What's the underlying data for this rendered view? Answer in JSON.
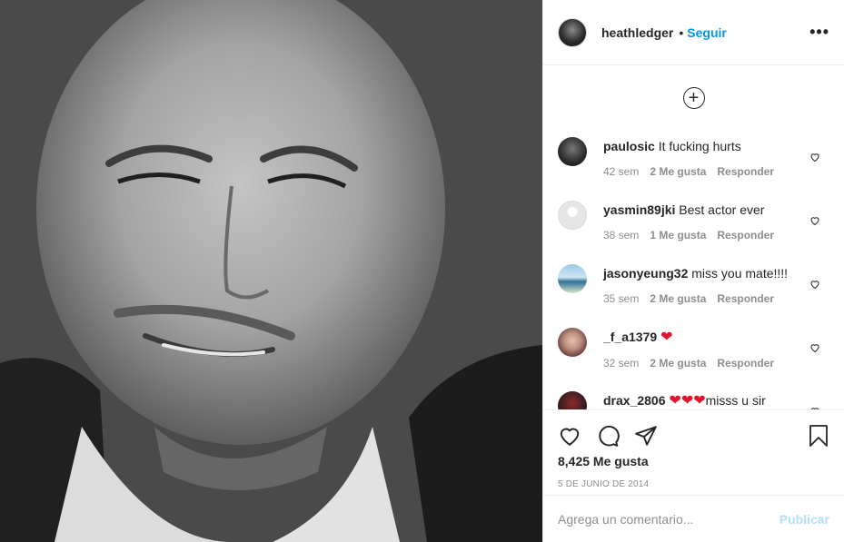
{
  "post": {
    "image_alt": "Black and white portrait photo"
  },
  "header": {
    "username": "heathledger",
    "separator": "•",
    "follow_label": "Seguir",
    "more_label": "•••"
  },
  "comments": {
    "load_more_label": "+",
    "items": [
      {
        "user": "paulosic",
        "text": "It fucking hurts",
        "emoji": "",
        "extra": "",
        "time": "42 sem",
        "likes": "2 Me gusta",
        "reply": "Responder",
        "avatar": "#2b2b2b"
      },
      {
        "user": "yasmin89jki",
        "text": "Best actor ever",
        "emoji": "",
        "extra": "",
        "time": "38 sem",
        "likes": "1 Me gusta",
        "reply": "Responder",
        "avatar": "#e8e8e8"
      },
      {
        "user": "jasonyeung32",
        "text": "miss you mate!!!!",
        "emoji": "",
        "extra": "",
        "time": "35 sem",
        "likes": "2 Me gusta",
        "reply": "Responder",
        "avatar": "#6fa8c8"
      },
      {
        "user": "_f_a1379",
        "text": "",
        "emoji": "❤",
        "extra": "",
        "time": "32 sem",
        "likes": "2 Me gusta",
        "reply": "Responder",
        "avatar": "#7a4a4a"
      },
      {
        "user": "drax_2806",
        "text": "",
        "emoji": "❤❤❤",
        "extra": "misss u sir",
        "time": "",
        "likes": "",
        "reply": "",
        "avatar": "#3a1f1f"
      }
    ]
  },
  "actions": {
    "like_icon": "heart-outline-icon",
    "comment_icon": "comment-bubble-icon",
    "share_icon": "paper-plane-icon",
    "save_icon": "bookmark-icon",
    "likes_count": "8,425 Me gusta",
    "date": "5 DE JUNIO DE 2014"
  },
  "add_comment": {
    "placeholder": "Agrega un comentario...",
    "post_label": "Publicar"
  },
  "colors": {
    "accent": "#0095f6",
    "post_disabled": "#b2dffc",
    "heart": "#e0142c",
    "muted": "#8e8e8e"
  }
}
